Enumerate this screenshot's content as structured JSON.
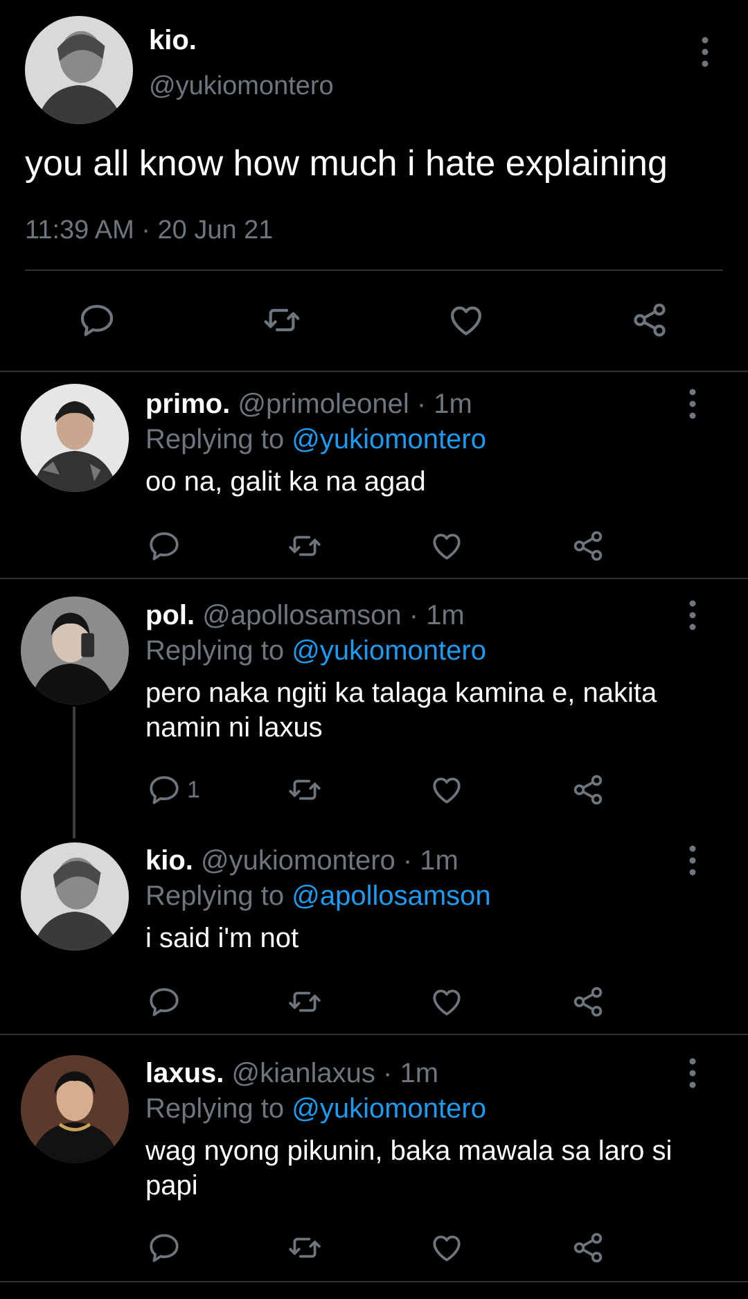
{
  "main_tweet": {
    "name": "kio.",
    "handle": "@yukiomontero",
    "text": "you all know how much i hate explaining",
    "timestamp": "11:39 AM · 20 Jun 21",
    "avatar_icon": "avatar-kio",
    "actions": [
      "reply-icon",
      "retweet-icon",
      "like-icon",
      "share-icon"
    ]
  },
  "replies": [
    {
      "name": "primo.",
      "handle_time": "@primoleonel · 1m",
      "replying_prefix": "Replying to ",
      "replying_to": "@yukiomontero",
      "text": "oo na, galit ka na agad",
      "reply_count": ""
    },
    {
      "name": "pol.",
      "handle_time": "@apollosamson · 1m",
      "replying_prefix": "Replying to ",
      "replying_to": "@yukiomontero",
      "text": "pero naka ngiti ka talaga kamina e, nakita namin ni laxus",
      "reply_count": "1"
    },
    {
      "name": "kio.",
      "handle_time": "@yukiomontero · 1m",
      "replying_prefix": "Replying to ",
      "replying_to": "@apollosamson",
      "text": "i said i'm not",
      "reply_count": ""
    },
    {
      "name": "laxus.",
      "handle_time": "@kianlaxus · 1m",
      "replying_prefix": "Replying to ",
      "replying_to": "@yukiomontero",
      "text": "wag nyong pikunin, baka mawala sa laro si papi",
      "reply_count": ""
    }
  ],
  "colors": {
    "background": "#000000",
    "text_primary": "#ffffff",
    "text_secondary": "#6e767d",
    "link": "#1d9bf0",
    "divider": "#2f3336"
  }
}
